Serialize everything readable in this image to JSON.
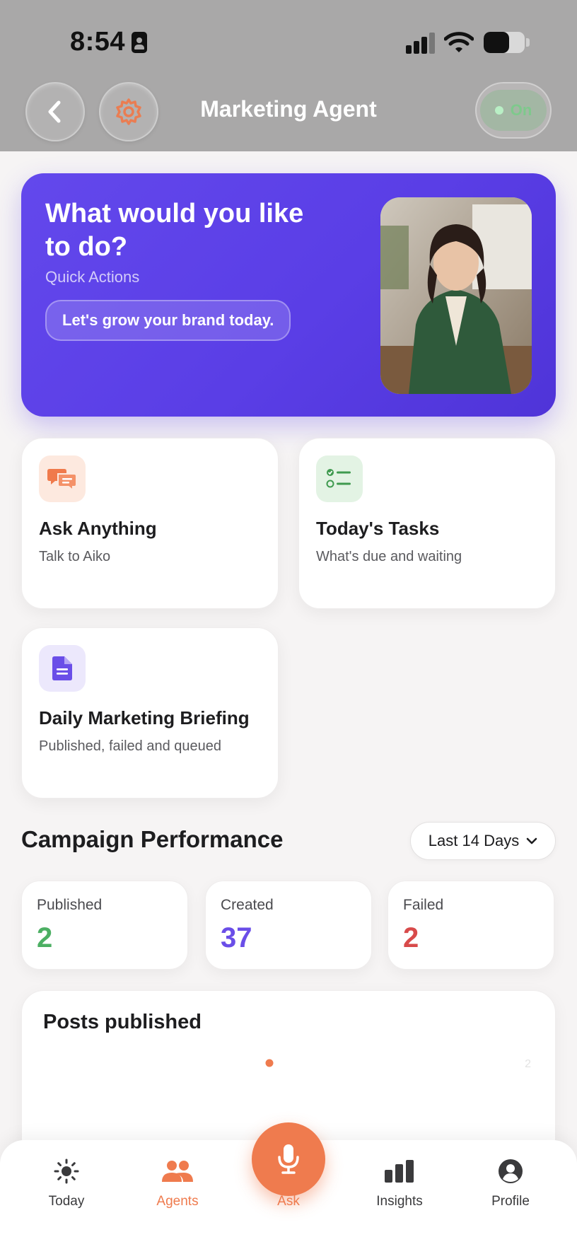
{
  "status_bar": {
    "time": "8:54"
  },
  "header": {
    "title": "Marketing Agent",
    "toggle_label": "On"
  },
  "hero": {
    "title": "What would you like to do?",
    "subtitle": "Quick Actions",
    "chip": "Let's grow your brand today."
  },
  "actions": [
    {
      "title": "Ask Anything",
      "subtitle": "Talk to Aiko",
      "icon": "chat-bubbles-icon",
      "color": "#f07a4b"
    },
    {
      "title": "Today's Tasks",
      "subtitle": "What's due and waiting",
      "icon": "checklist-icon",
      "color": "#3f9a4f"
    },
    {
      "title": "Daily Marketing Briefing",
      "subtitle": "Published, failed and queued",
      "icon": "document-icon",
      "color": "#6a4ee8"
    }
  ],
  "performance": {
    "title": "Campaign Performance",
    "range": "Last 14 Days",
    "stats": [
      {
        "label": "Published",
        "value": "2",
        "color": "#4caf63"
      },
      {
        "label": "Created",
        "value": "37",
        "color": "#6a4ee8"
      },
      {
        "label": "Failed",
        "value": "2",
        "color": "#d84a4a"
      }
    ]
  },
  "posts_chart": {
    "title": "Posts published",
    "axis_label": "2"
  },
  "chart_data": {
    "type": "line",
    "title": "Posts published",
    "series": [
      {
        "values": [
          2
        ]
      }
    ],
    "ylim": [
      0,
      2
    ]
  },
  "tabbar": {
    "items": [
      {
        "label": "Today",
        "icon": "sun-icon"
      },
      {
        "label": "Agents",
        "icon": "people-icon",
        "active": true
      },
      {
        "label": "Ask",
        "icon": "microphone-icon"
      },
      {
        "label": "Insights",
        "icon": "bar-chart-icon"
      },
      {
        "label": "Profile",
        "icon": "user-circle-icon"
      }
    ],
    "accent": "#ef7b4e"
  }
}
